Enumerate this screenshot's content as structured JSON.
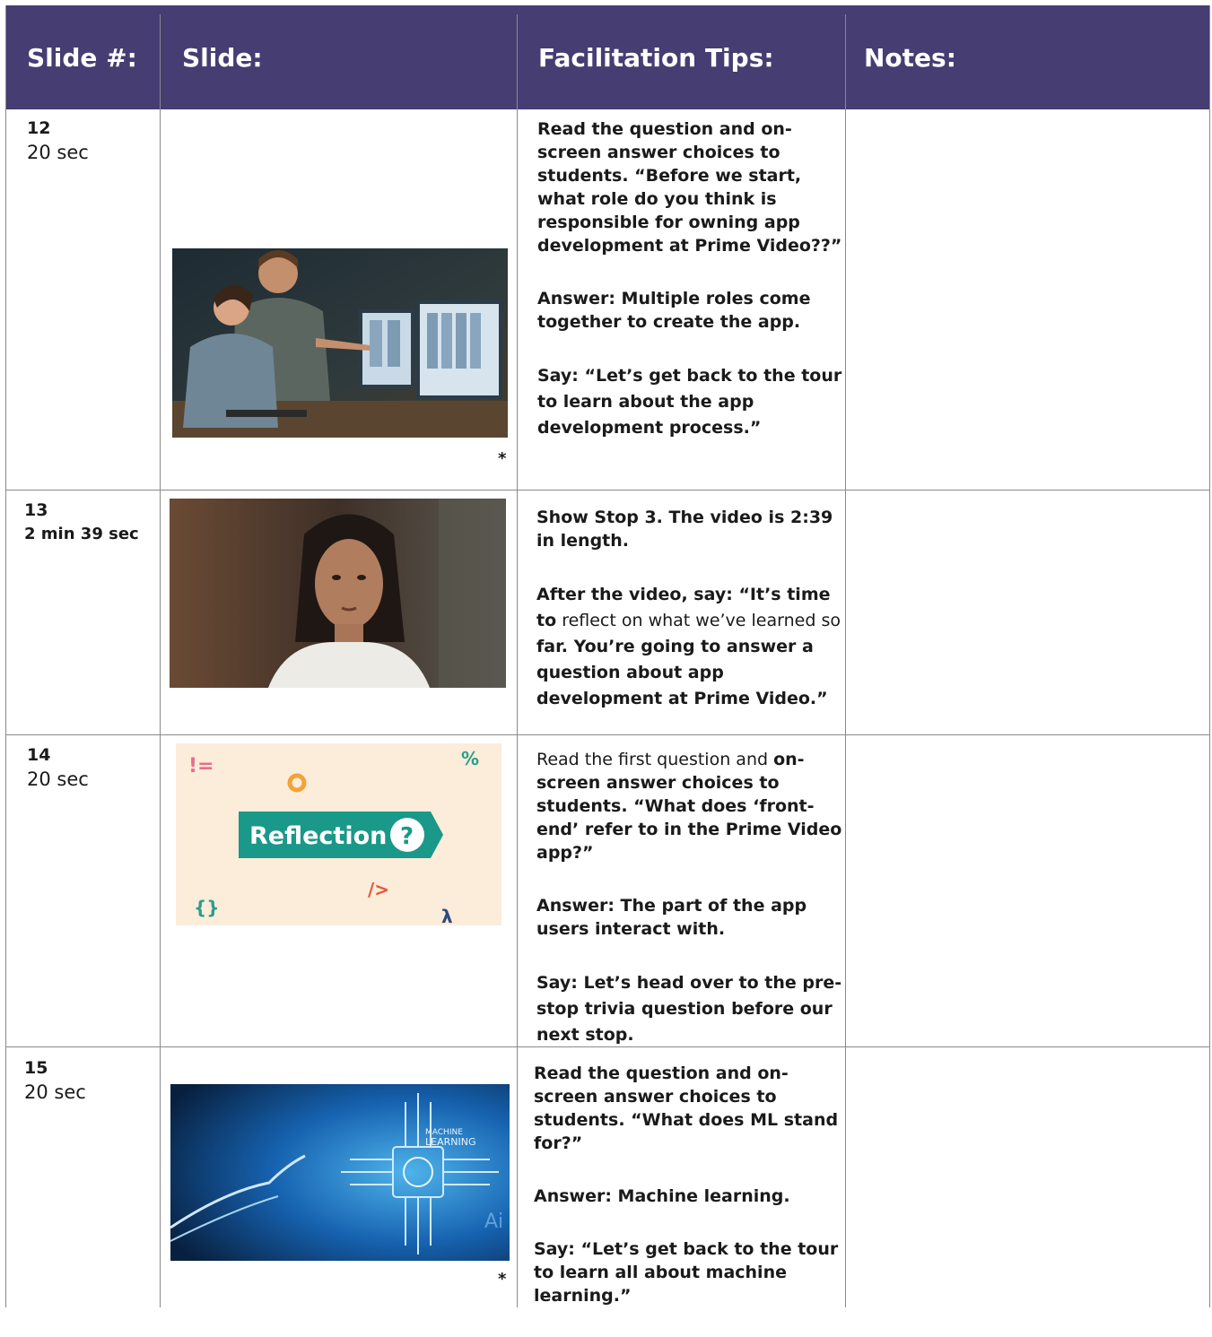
{
  "header": {
    "col1": "Slide #:",
    "col2": "Slide:",
    "col3": "Facilitation Tips:",
    "col4": "Notes:"
  },
  "colors": {
    "header_bg": "#463d72",
    "header_text": "#ffffff"
  },
  "rows": [
    {
      "number": "12",
      "duration": "20 sec",
      "image": "photo-two-people-at-monitors",
      "image_note": "*",
      "tips": [
        "Read the question and on-screen answer choices to students. “Before we start, what role do you think is responsible for owning app development at Prime Video??”",
        "Answer: Multiple roles come together to create the app.",
        "Say: “Let’s get back to the tour to learn about the app development process.”"
      ]
    },
    {
      "number": "13",
      "duration": "2 min 39 sec",
      "image": "photo-woman-speaking",
      "tips": [
        "Show Stop 3. The video is 2:39 in length.",
        {
          "a": "After the video, say: “It’s time to",
          "b": "reflect on what we’ve learned so",
          "c": "far. You’re going to answer a question about app development at Prime Video.”"
        }
      ]
    },
    {
      "number": "14",
      "duration": "20 sec",
      "image": "reflection-graphic",
      "image_label": "Reflection",
      "image_symbol": "?",
      "tips": [
        {
          "a": "Read the first question and",
          "b": "on-screen answer choices to students. “What does ‘front-end’ refer to in the Prime Video app?”"
        },
        "Answer: The part of the app users interact with.",
        "Say: Let’s head over to the pre-stop trivia question before our next stop."
      ]
    },
    {
      "number": "15",
      "duration": "20 sec",
      "image": "machine-learning-graphic",
      "image_label_1": "MACHINE",
      "image_label_2": "LEARNING",
      "image_label_3": "Ai",
      "image_note": "*",
      "tips": [
        "Read the question and on-screen answer choices to students. “What does ML stand for?”",
        "Answer: Machine learning.",
        "Say: “Let’s get back to the tour to learn all about machine learning.”"
      ]
    }
  ]
}
